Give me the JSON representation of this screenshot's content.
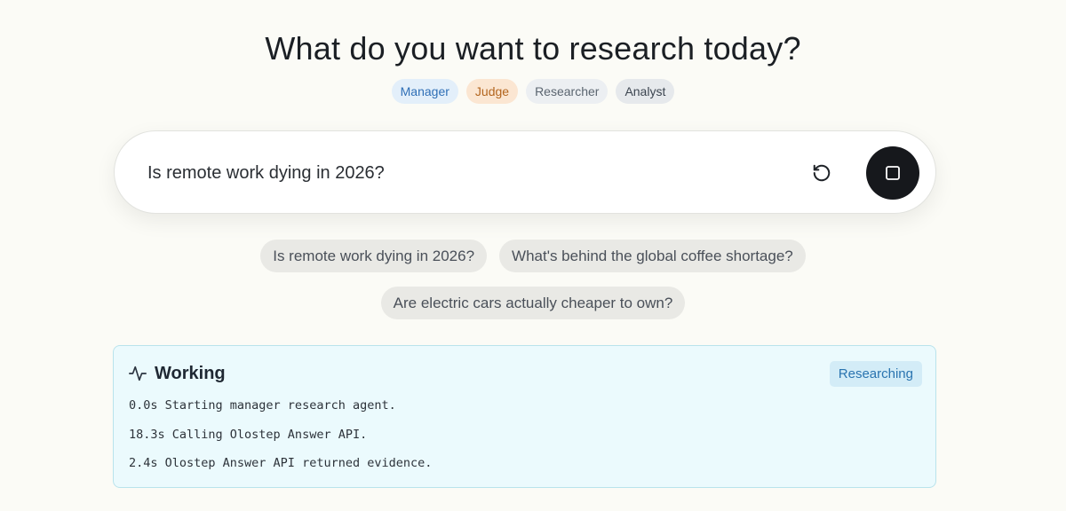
{
  "heading": "What do you want to research today?",
  "agents": [
    {
      "label": "Manager"
    },
    {
      "label": "Judge"
    },
    {
      "label": "Researcher"
    },
    {
      "label": "Analyst"
    }
  ],
  "search": {
    "value": "Is remote work dying in 2026?",
    "reset_icon": "rotate-ccw-icon",
    "stop_icon": "stop-square-icon"
  },
  "suggestions": [
    "Is remote work dying in 2026?",
    "What's behind the global coffee shortage?",
    "Are electric cars actually cheaper to own?"
  ],
  "progress": {
    "icon": "activity-icon",
    "title": "Working",
    "status": "Researching",
    "log": [
      "0.0s Starting manager research agent.",
      "18.3s Calling Olostep Answer API.",
      "2.4s Olostep Answer API returned evidence."
    ]
  },
  "colors": {
    "background": "#fbfbf6",
    "stop_button": "#16181c",
    "panel_background": "#ebfafd",
    "panel_border": "#b9e3ec",
    "status_badge": "#d3ecf7"
  }
}
